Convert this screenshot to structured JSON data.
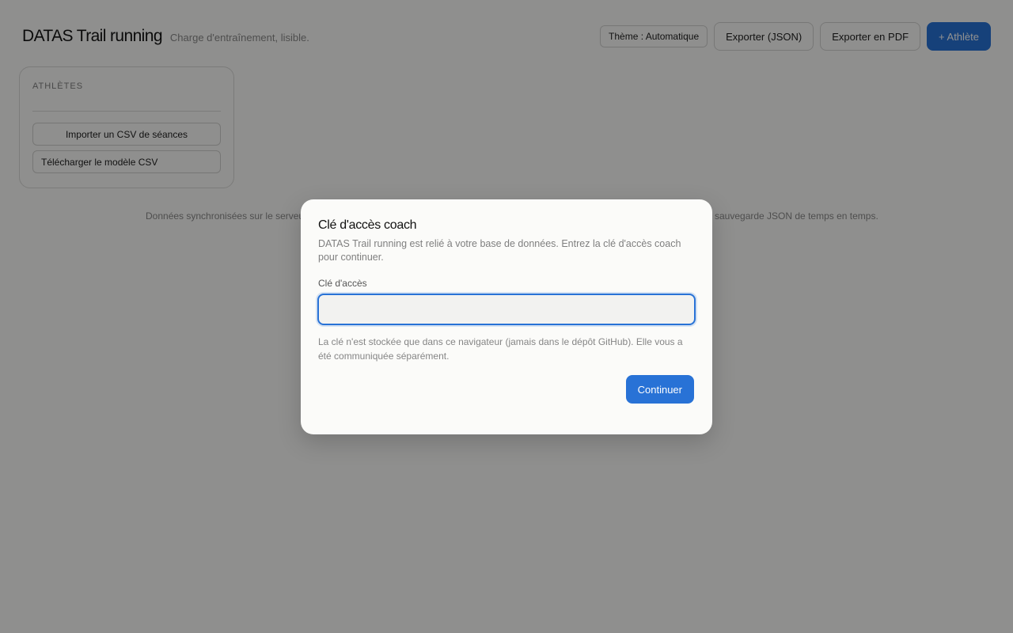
{
  "header": {
    "title": "DATAS Trail running",
    "tagline": "Charge d'entraînement, lisible.",
    "theme_label": "Thème : Automatique",
    "export_json_label": "Exporter (JSON)",
    "export_pdf_label": "Exporter en PDF",
    "add_athlete_label": "+ Athlète"
  },
  "sidebar": {
    "title": "ATHLÈTES",
    "import_csv_label": "Importer un CSV de séances",
    "download_template_label": "Télécharger le modèle CSV"
  },
  "footer_note": "Données synchronisées sur le serveur",
  "footer_note_tail": "sauvegarde JSON de temps en temps.",
  "modal": {
    "title": "Clé d'accès coach",
    "description": "DATAS Trail running est relié à votre base de données. Entrez la clé d'accès coach pour continuer.",
    "field_label": "Clé d'accès",
    "field_value": "",
    "field_placeholder": "",
    "hint": "La clé n'est stockée que dans ce navigateur (jamais dans le dépôt GitHub). Elle vous a été communiquée séparément.",
    "continue_label": "Continuer"
  },
  "colors": {
    "accent": "#2872d6",
    "background": "#fbfbf9",
    "overlay": "rgba(0,0,0,0.43)"
  }
}
